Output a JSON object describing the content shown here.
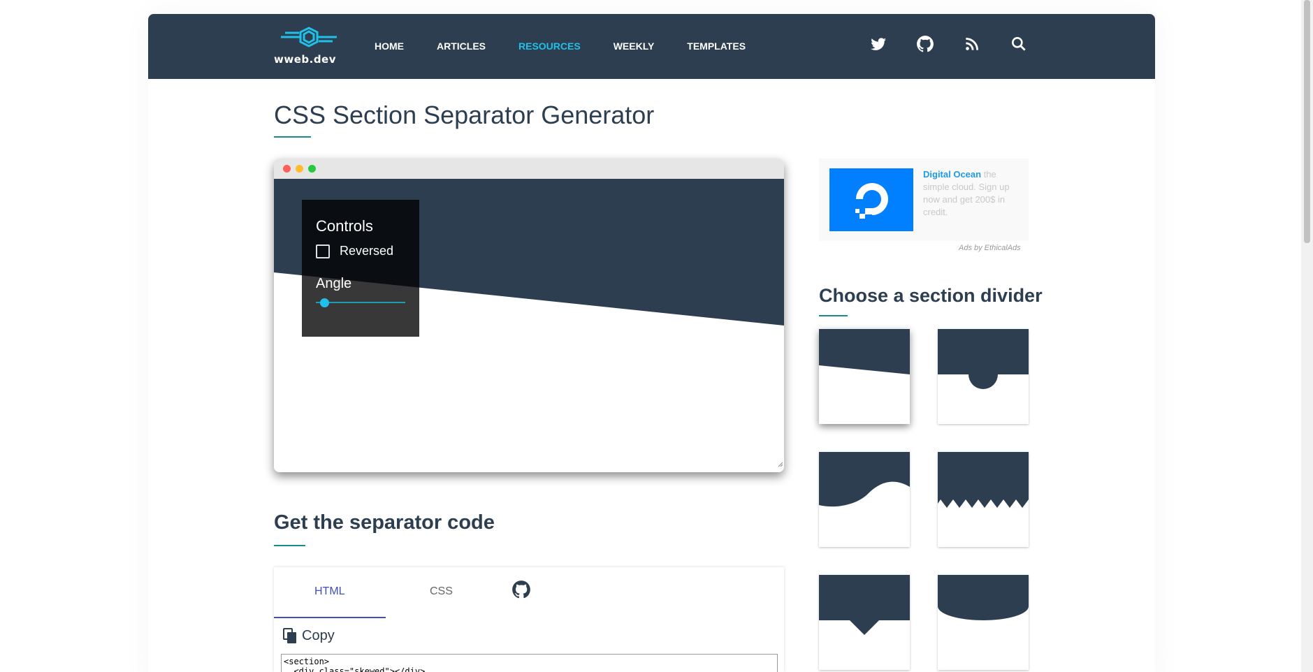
{
  "header": {
    "logo_text": "wweb.dev",
    "nav": [
      {
        "label": "HOME",
        "active": false
      },
      {
        "label": "ARTICLES",
        "active": false
      },
      {
        "label": "RESOURCES",
        "active": true
      },
      {
        "label": "WEEKLY",
        "active": false
      },
      {
        "label": "TEMPLATES",
        "active": false
      }
    ],
    "social_icons": [
      "twitter-icon",
      "github-icon",
      "rss-icon",
      "search-icon"
    ]
  },
  "page": {
    "title": "CSS Section Separator Generator",
    "code_section_title": "Get the separator code",
    "divider_section_title": "Choose a section divider"
  },
  "preview": {
    "controls_title": "Controls",
    "reversed_label": "Reversed",
    "reversed_checked": false,
    "angle_label": "Angle",
    "angle_fraction": 0.05
  },
  "code_tabs": {
    "tabs": [
      {
        "label": "HTML",
        "active": true
      },
      {
        "label": "CSS",
        "active": false
      }
    ],
    "copy_label": "Copy",
    "code_text": "<section>\n  <div class=\"skewed\"></div>"
  },
  "ad": {
    "brand": "Digital Ocean",
    "text": " the simple cloud. Sign up now and get 200$ in credit.",
    "attribution": "Ads by EthicalAds"
  },
  "dividers": [
    {
      "name": "skewed",
      "selected": true
    },
    {
      "name": "curved",
      "selected": false
    },
    {
      "name": "wave",
      "selected": false
    },
    {
      "name": "spikes",
      "selected": false
    },
    {
      "name": "triangle",
      "selected": false
    },
    {
      "name": "oval",
      "selected": false
    }
  ],
  "colors": {
    "header_bg": "#2d3e50",
    "accent": "#20c0e8",
    "tab_active": "#3f51b5",
    "underline": "#1b8a8a"
  }
}
